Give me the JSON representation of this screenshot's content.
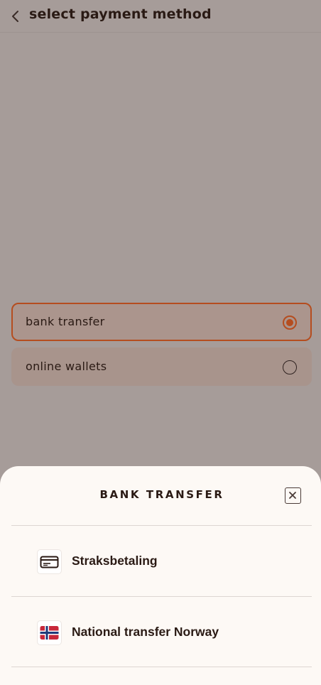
{
  "header": {
    "title": "select payment method",
    "back_icon": "chevron-left-icon"
  },
  "options": [
    {
      "label": "bank transfer",
      "selected": true
    },
    {
      "label": "online wallets",
      "selected": false
    }
  ],
  "sheet": {
    "title": "BANK TRANSFER",
    "close_icon": "close-icon",
    "methods": [
      {
        "label": "Straksbetaling",
        "icon": "card-icon"
      },
      {
        "label": "National transfer Norway",
        "icon": "norway-flag-icon"
      }
    ]
  },
  "colors": {
    "accent": "#b54d1f",
    "overlay_background": "#a69c99",
    "sheet_background": "#fdf9f5",
    "text": "#2a1a14"
  }
}
